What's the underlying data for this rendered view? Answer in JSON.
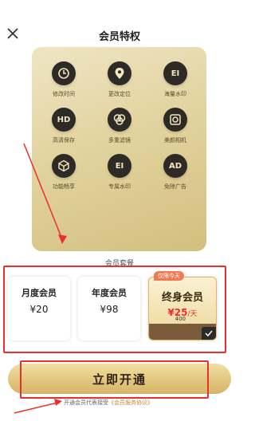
{
  "header": {
    "title": "会员特权",
    "close_icon": "close-icon"
  },
  "features": [
    {
      "label": "修改时间",
      "icon": "clock-icon"
    },
    {
      "label": "更改定位",
      "icon": "location-pin-icon"
    },
    {
      "label": "海量水印",
      "icon": "watermark-icon",
      "glyph": "EI"
    },
    {
      "label": "高清保存",
      "icon": "hd-icon",
      "glyph": "HD"
    },
    {
      "label": "多重滤镜",
      "icon": "filter-icon"
    },
    {
      "label": "美颜相机",
      "icon": "camera-icon"
    },
    {
      "label": "功能畅享",
      "icon": "cube-icon"
    },
    {
      "label": "专属水印",
      "icon": "exclusive-watermark-icon",
      "glyph": "EI"
    },
    {
      "label": "免除广告",
      "icon": "ad-icon",
      "glyph": "AD"
    }
  ],
  "plans_section": {
    "label": "会员套餐"
  },
  "plans": [
    {
      "name": "月度会员",
      "price": "¥20"
    },
    {
      "name": "年度会员",
      "price": "¥98"
    },
    {
      "name": "终身会员",
      "price": "¥25",
      "unit": "/天",
      "badge": "仅限今天",
      "strip_value": "400",
      "selected": true
    }
  ],
  "cta": {
    "label": "立即开通"
  },
  "agreement": {
    "text": "开通会员代表接受",
    "link": "《会员服务协议》"
  },
  "colors": {
    "accent_gold": "#e2c67d",
    "annotation_red": "#e8312f",
    "icon_dark": "#2e2b27"
  }
}
